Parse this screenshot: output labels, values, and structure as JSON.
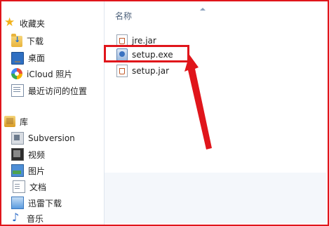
{
  "nav": {
    "favorites_label": "收藏夹",
    "items": [
      {
        "label": "下载",
        "icon": "download-folder-icon"
      },
      {
        "label": "桌面",
        "icon": "desktop-icon"
      },
      {
        "label": "iCloud 照片",
        "icon": "icloud-photos-icon"
      },
      {
        "label": "最近访问的位置",
        "icon": "recent-places-icon"
      }
    ],
    "library_label": "库",
    "library_items": [
      {
        "label": "Subversion",
        "icon": "library-icon"
      },
      {
        "label": "视频",
        "icon": "video-icon"
      },
      {
        "label": "图片",
        "icon": "picture-icon"
      },
      {
        "label": "文档",
        "icon": "document-icon"
      },
      {
        "label": "迅雷下载",
        "icon": "xunlei-download-icon"
      },
      {
        "label": "音乐",
        "icon": "music-icon"
      }
    ]
  },
  "content": {
    "column_header": "名称",
    "files": [
      {
        "name": "jre.jar",
        "icon": "jar-file-icon"
      },
      {
        "name": "setup.exe",
        "icon": "exe-file-icon"
      },
      {
        "name": "setup.jar",
        "icon": "jar-file-icon"
      }
    ]
  },
  "colors": {
    "annotation_red": "#e0151b",
    "star": "#f2b21b"
  }
}
